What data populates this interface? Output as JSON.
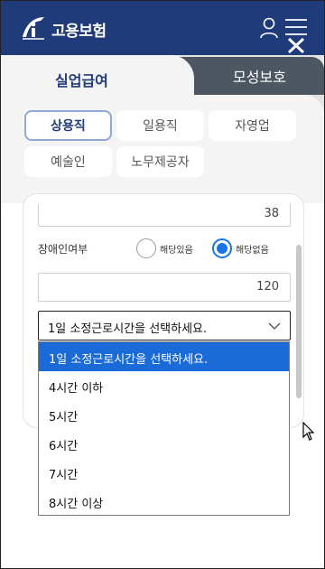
{
  "header": {
    "logo_text": "고용보험",
    "icons": [
      "logo-icon",
      "user-icon",
      "menu-icon",
      "close-icon"
    ],
    "background": "#1f3b7a"
  },
  "tabs": {
    "primary": "실업급여",
    "secondary": "모성보호"
  },
  "job_types": [
    {
      "label": "상용직",
      "active": true
    },
    {
      "label": "일용직",
      "active": false
    },
    {
      "label": "자영업",
      "active": false
    },
    {
      "label": "예술인",
      "active": false
    },
    {
      "label": "노무제공자",
      "active": false
    }
  ],
  "form": {
    "top_field_value": "38",
    "disability_label": "장애인여부",
    "radio_yes": "해당있음",
    "radio_no": "해당없음",
    "selected_radio": "해당없음",
    "number_field_value": "120",
    "hours_select_value": "1일 소정근로시간을 선택하세요."
  },
  "dropdown_options": [
    "1일 소정근로시간을 선택하세요.",
    "4시간 이하",
    "5시간",
    "6시간",
    "7시간",
    "8시간 이상"
  ],
  "colors": {
    "accent": "#1a6ad8",
    "header": "#1f3b7a",
    "tab_inactive": "#4d5761"
  }
}
